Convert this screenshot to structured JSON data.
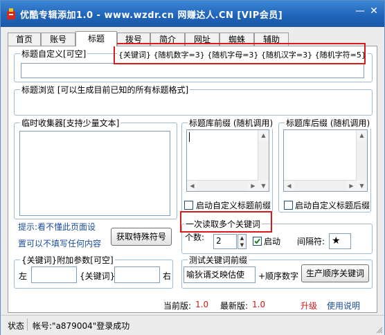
{
  "window": {
    "title": "优酷专辑添加1.0 - www.wzdr.cn 网赚达人.CN [VIP会员]",
    "min_label": "—",
    "close_label": "✕"
  },
  "tabs": [
    {
      "label": "首页"
    },
    {
      "label": "账号"
    },
    {
      "label": "标题",
      "active": true
    },
    {
      "label": "拨号"
    },
    {
      "label": "简介"
    },
    {
      "label": "网址"
    },
    {
      "label": "蜘蛛"
    },
    {
      "label": "辅助"
    }
  ],
  "title_custom": {
    "legend": "标题自定义[可空]",
    "hint": "{关键词} {随机数字=3} {随机字母=3} {随机汉字=3} {随机字符=5}",
    "value": ""
  },
  "title_preview": {
    "legend": "标题浏览 [可以生成目前已知的所有标题格式]"
  },
  "temp_collector": {
    "legend": "临时收集器[支持少量文本]"
  },
  "prefix_lib": {
    "legend": "标题库前缀 (随机调用)",
    "checkbox_label": "启动自定义标题前缀"
  },
  "suffix_lib": {
    "legend": "标题库后缀 (随机调用)",
    "checkbox_label": "启动自定义标题后缀"
  },
  "tips": {
    "line1": "提示:看不懂此页面设",
    "line2": "置可以不填写任何内容"
  },
  "special_symbol_button": "获取特殊符号",
  "multi_keyword": {
    "legend": "一次读取多个关键词",
    "count_label": "个数:",
    "count_value": "2",
    "enable_label": "启动",
    "separator_label": "间隔符:",
    "separator_value": "★"
  },
  "keyword_params": {
    "legend": "{关键词}附加参数[可空]",
    "left_label": "左",
    "middle_label": "{关键词}",
    "right_label": "右"
  },
  "test_prefix": {
    "legend": "测试关键词前缀",
    "input_value": "喻狄谞爻映估使",
    "order_label": "+顺序数字",
    "generate_button": "生产顺序关键词"
  },
  "version": {
    "current_label": "当前版:",
    "current_value": "1.0",
    "latest_label": "最新版:",
    "latest_value": "1.0",
    "upgrade": "升级",
    "help": "使用说明"
  },
  "status": {
    "label": "状态",
    "message": "帐号:\"a879004\"登录成功"
  },
  "colors": {
    "titlebar": "#1f63b8",
    "highlight_box": "#d91a1a",
    "link_blue": "#1a4d9a",
    "link_red": "#d0171b"
  }
}
